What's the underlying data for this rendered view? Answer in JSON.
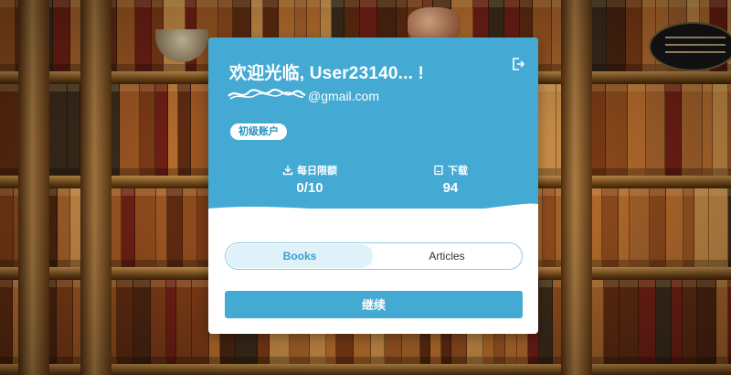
{
  "colors": {
    "accent": "#44aad3",
    "badge_text": "#2b8fbd",
    "tab_active_bg": "#dff1f9"
  },
  "card": {
    "welcome": "欢迎光临, User23140... !",
    "email_visible": "@gmail.com",
    "badge": "初级账户",
    "logout_icon": "logout-icon"
  },
  "stats": {
    "limit_label": "每日限额",
    "limit_value": "0/10",
    "limit_icon": "download-icon",
    "downloads_label": "下载",
    "downloads_value": "94",
    "downloads_icon": "book-icon"
  },
  "tabs": {
    "books": "Books",
    "articles": "Articles",
    "active": "Books"
  },
  "actions": {
    "continue": "继续"
  }
}
